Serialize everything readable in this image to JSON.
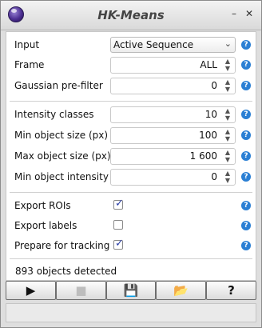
{
  "window": {
    "title": "HK-Means",
    "minimize_glyph": "–",
    "close_glyph": "✕"
  },
  "params": {
    "input": {
      "label": "Input",
      "value": "Active Sequence"
    },
    "frame": {
      "label": "Frame",
      "value": "ALL"
    },
    "gaussian": {
      "label": "Gaussian pre-filter",
      "value": "0"
    },
    "intensity_classes": {
      "label": "Intensity classes",
      "value": "10"
    },
    "min_size": {
      "label": "Min object size (px)",
      "value": "100"
    },
    "max_size": {
      "label": "Max object size (px)",
      "value": "1 600"
    },
    "min_intensity": {
      "label": "Min object intensity",
      "value": "0"
    }
  },
  "options": {
    "export_rois": {
      "label": "Export ROIs",
      "checked": true
    },
    "export_labels": {
      "label": "Export labels",
      "checked": false
    },
    "prepare_tracking": {
      "label": "Prepare for tracking",
      "checked": true
    }
  },
  "status": {
    "text": "893 objects detected"
  },
  "glyphs": {
    "help": "?",
    "dropdown": "⌄",
    "spin_up": "▲",
    "spin_down": "▼",
    "check": "✓"
  },
  "toolbar": {
    "run": "▶",
    "stop": "■",
    "save": "💾",
    "open": "📂",
    "help": "?"
  },
  "colors": {
    "help_icon": "#2a7fd4",
    "checkmark": "#2b3fa8"
  }
}
